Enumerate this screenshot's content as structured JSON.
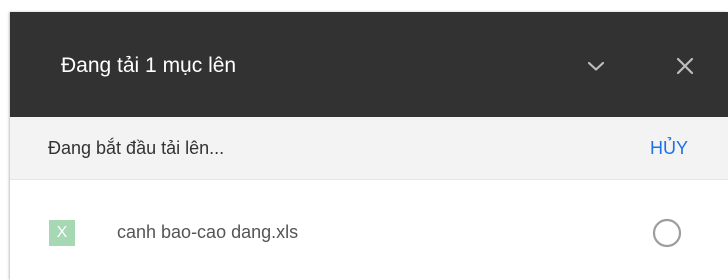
{
  "header": {
    "title": "Đang tải 1 mục lên"
  },
  "status": {
    "text": "Đang bắt đầu tải lên...",
    "cancel_label": "HỦY"
  },
  "files": [
    {
      "icon_letter": "X",
      "icon_name": "excel-file-icon",
      "name": "canh bao-cao dang.xls"
    }
  ],
  "colors": {
    "header_bg": "#323232",
    "accent": "#1a73e8",
    "file_icon_bg": "#a6d8b4"
  }
}
